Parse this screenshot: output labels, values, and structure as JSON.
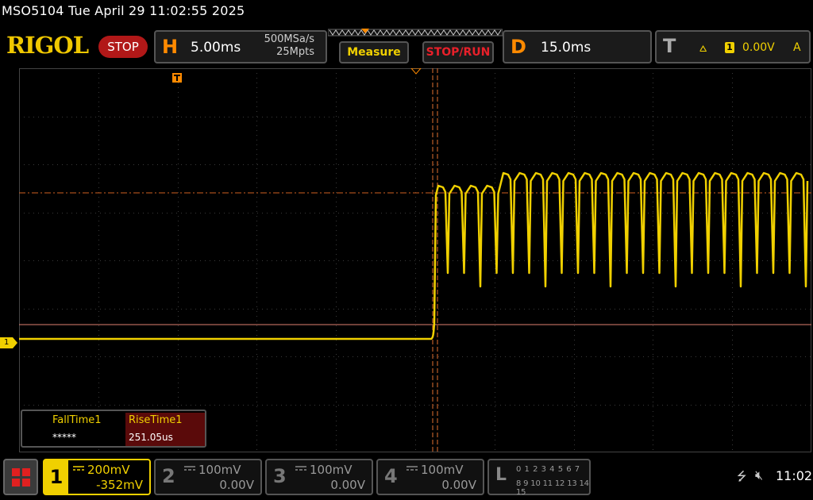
{
  "header": {
    "status_line": "MSO5104  Tue April 29 11:02:55 2025",
    "logo": "RIGOL",
    "run_state": "STOP"
  },
  "horizontal": {
    "letter": "H",
    "timebase": "5.00ms",
    "sample_rate": "500MSa/s",
    "memory_depth": "25Mpts"
  },
  "buttons": {
    "measure": "Measure",
    "stop_run": "STOP/RUN"
  },
  "delay": {
    "letter": "D",
    "value": "15.0ms"
  },
  "trigger": {
    "letter": "T",
    "slope_icon": "rising-edge-icon",
    "channel": "1",
    "level": "0.00V",
    "mode": "A"
  },
  "waveform": {
    "channel_marker": "1",
    "color": "#f0d000",
    "cursor_color": "#e04010",
    "trigger_marker_color": "#ff8a00"
  },
  "measurements": {
    "fall_label": "FallTime1",
    "fall_value": "*****",
    "rise_label": "RiseTime1",
    "rise_value": "251.05us"
  },
  "channels": [
    {
      "num": "1",
      "scale": "200mV",
      "offset": "-352mV",
      "active": true
    },
    {
      "num": "2",
      "scale": "100mV",
      "offset": "0.00V",
      "active": false
    },
    {
      "num": "3",
      "scale": "100mV",
      "offset": "0.00V",
      "active": false
    },
    {
      "num": "4",
      "scale": "100mV",
      "offset": "0.00V",
      "active": false
    }
  ],
  "logic": {
    "letter": "L",
    "row1": "0 1 2 3  4 5 6 7",
    "row2": "8 9 10 11 12 13 14 15"
  },
  "system": {
    "usb_icon": "usb-icon",
    "sound_icon": "speaker-muted-icon",
    "clock": "11:02"
  }
}
